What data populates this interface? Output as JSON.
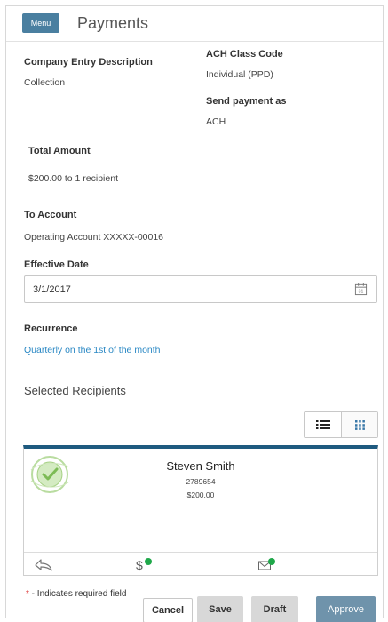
{
  "header": {
    "menu_label": "Menu",
    "title": "Payments"
  },
  "form": {
    "company_entry_description": {
      "label": "Company Entry Description",
      "value": "Collection"
    },
    "ach_class_code": {
      "label": "ACH Class Code",
      "value": "Individual (PPD)"
    },
    "send_payment_as": {
      "label": "Send payment as",
      "value": "ACH"
    },
    "total_amount": {
      "label": "Total Amount",
      "value": "$200.00 to 1 recipient"
    },
    "to_account": {
      "label": "To Account",
      "value": "Operating Account XXXXX-00016"
    },
    "effective_date": {
      "label": "Effective Date",
      "value": "3/1/2017",
      "calendar_day": "31"
    },
    "recurrence": {
      "label": "Recurrence",
      "value": "Quarterly on the 1st of the month"
    }
  },
  "recipients": {
    "title": "Selected Recipients",
    "view_modes": [
      "list",
      "grid"
    ],
    "items": [
      {
        "name": "Steven Smith",
        "id": "2789654",
        "amount": "$200.00"
      }
    ]
  },
  "footer": {
    "required_star": "*",
    "required_text": " - Indicates required field",
    "buttons": {
      "cancel": "Cancel",
      "save": "Save",
      "draft": "Draft",
      "approve": "Approve"
    }
  },
  "colors": {
    "menu_button": "#4a7fa0",
    "link": "#2a88c4",
    "card_top_border": "#1e5a7f",
    "approve_button": "#6f93ab",
    "status_dot": "#1fa84a",
    "required_star": "#dd3333"
  }
}
